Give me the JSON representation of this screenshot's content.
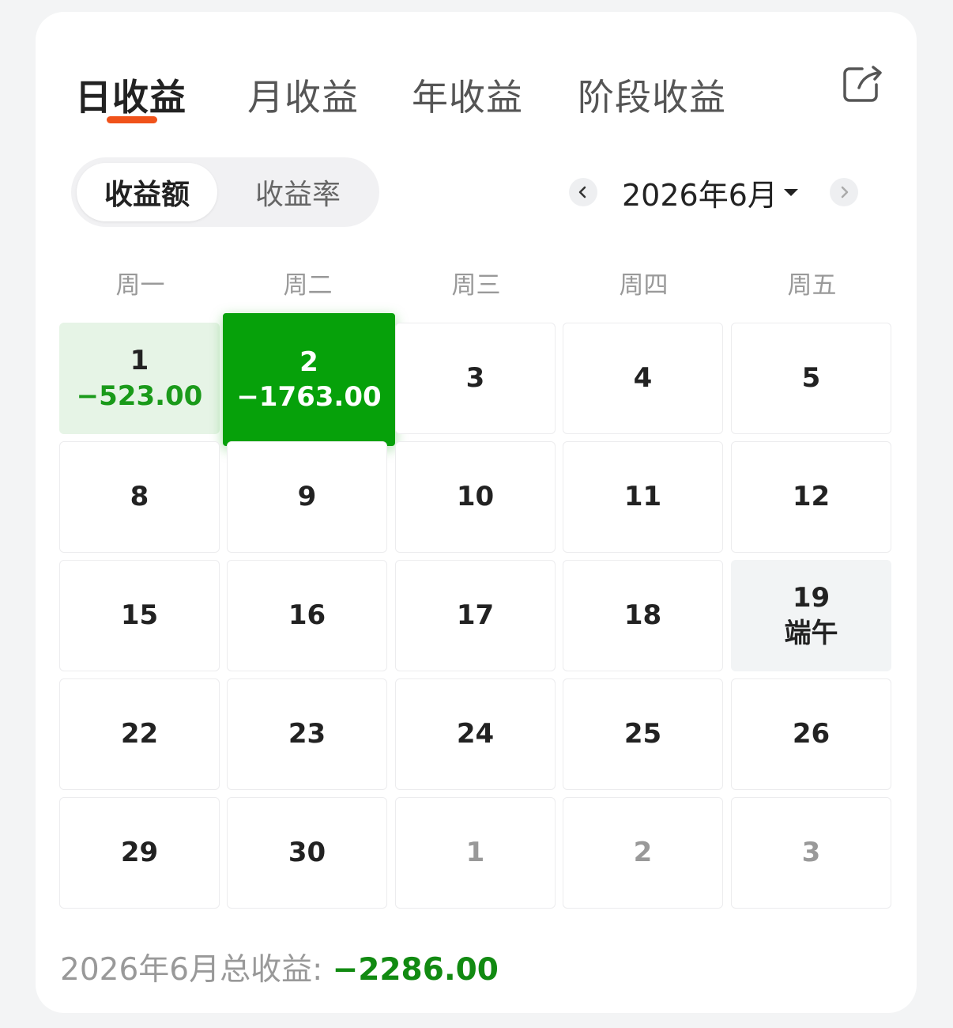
{
  "tabs": [
    {
      "label": "日收益",
      "active": true
    },
    {
      "label": "月收益",
      "active": false
    },
    {
      "label": "年收益",
      "active": false
    },
    {
      "label": "阶段收益",
      "active": false
    }
  ],
  "toggle": {
    "options": [
      "收益额",
      "收益率"
    ],
    "selected": "收益额"
  },
  "month_nav": {
    "label": "2026年6月",
    "prev_icon": "chevron-left-icon",
    "next_icon": "chevron-right-icon"
  },
  "weekdays": [
    "周一",
    "周二",
    "周三",
    "周四",
    "周五"
  ],
  "days": [
    {
      "day": "1",
      "value": "−523.00",
      "style": "light-green"
    },
    {
      "day": "2",
      "value": "−1763.00",
      "style": "strong-green"
    },
    {
      "day": "3"
    },
    {
      "day": "4"
    },
    {
      "day": "5"
    },
    {
      "day": "8"
    },
    {
      "day": "9"
    },
    {
      "day": "10"
    },
    {
      "day": "11"
    },
    {
      "day": "12"
    },
    {
      "day": "15"
    },
    {
      "day": "16"
    },
    {
      "day": "17"
    },
    {
      "day": "18"
    },
    {
      "day": "19",
      "note": "端午",
      "style": "holiday"
    },
    {
      "day": "22"
    },
    {
      "day": "23"
    },
    {
      "day": "24"
    },
    {
      "day": "25"
    },
    {
      "day": "26"
    },
    {
      "day": "29"
    },
    {
      "day": "30"
    },
    {
      "day": "1",
      "style": "other"
    },
    {
      "day": "2",
      "style": "other"
    },
    {
      "day": "3",
      "style": "other"
    }
  ],
  "total": {
    "label": "2026年6月总收益: ",
    "value": "−2286.00"
  },
  "colors": {
    "accent": "#f0521a",
    "loss_strong": "#06a10a",
    "loss_light": "#e6f4e6",
    "loss_text": "#118a11"
  }
}
